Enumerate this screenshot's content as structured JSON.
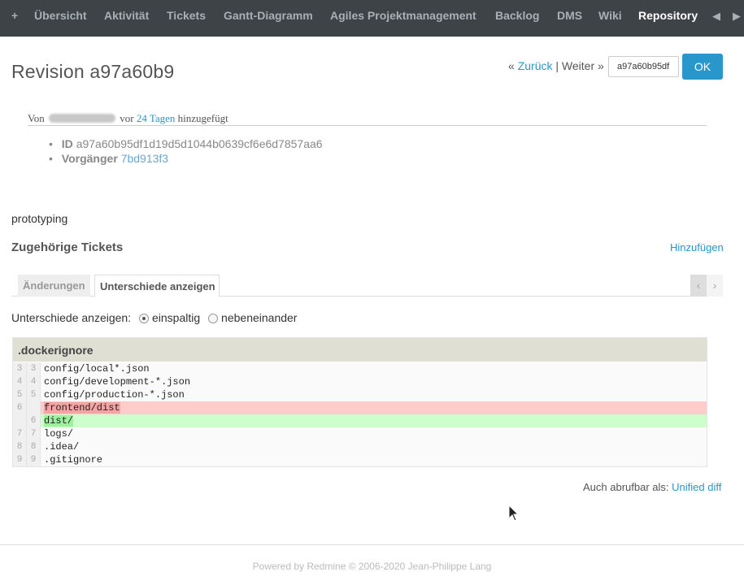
{
  "nav": {
    "items": [
      "+",
      "Übersicht",
      "Aktivität",
      "Tickets",
      "Gantt-Diagramm",
      "Agiles Projektmanagement",
      "Backlog",
      "DMS",
      "Wiki",
      "Repository"
    ],
    "active": "Repository",
    "scroll_left": "◀",
    "scroll_right": "▶"
  },
  "revision": {
    "title": "Revision a97a60b9",
    "prev_prefix": "«",
    "prev_label": "Zurück",
    "separator": "|",
    "next_label": "Weiter",
    "next_suffix": "»",
    "input_value": "a97a60b95df",
    "ok_label": "OK"
  },
  "author": {
    "prefix": "Von",
    "middle": "vor",
    "age": "24 Tagen",
    "suffix": "hinzugefügt"
  },
  "properties": {
    "id_label": "ID",
    "id_value": "a97a60b95df1d19d5d1044b0639cf6e6d7857aa6",
    "parent_label": "Vorgänger",
    "parent_value": "7bd913f3"
  },
  "comment": "prototyping",
  "related": {
    "title": "Zugehörige Tickets",
    "add_label": "Hinzufügen"
  },
  "tabs": {
    "changes": "Änderungen",
    "diff": "Unterschiede anzeigen",
    "scroll_left": "‹",
    "scroll_right": "›"
  },
  "diff_mode": {
    "label": "Unterschiede anzeigen:",
    "inline": "einspaltig",
    "side_by_side": "nebeneinander",
    "selected": "einspaltig"
  },
  "diff": {
    "filename": ".dockerignore",
    "lines": [
      {
        "old": "3",
        "new": "3",
        "type": "context",
        "text": "config/local*.json"
      },
      {
        "old": "4",
        "new": "4",
        "type": "context",
        "text": "config/development-*.json"
      },
      {
        "old": "5",
        "new": "5",
        "type": "context",
        "text": "config/production-*.json"
      },
      {
        "old": "6",
        "new": "",
        "type": "del",
        "text": "frontend/dist"
      },
      {
        "old": "",
        "new": "6",
        "type": "add",
        "text": "dist/"
      },
      {
        "old": "7",
        "new": "7",
        "type": "context",
        "text": "logs/"
      },
      {
        "old": "8",
        "new": "8",
        "type": "context",
        "text": ".idea/"
      },
      {
        "old": "9",
        "new": "9",
        "type": "context",
        "text": ".gitignore"
      }
    ]
  },
  "also_available": {
    "label": "Auch abrufbar als:",
    "link": "Unified diff"
  },
  "footer": "Powered by Redmine © 2006-2020 Jean-Philippe Lang",
  "colors": {
    "nav_bg": "#3e4347",
    "accent": "#2996cc",
    "diff_del": "#ffcccc",
    "diff_add": "#ccffcc"
  }
}
